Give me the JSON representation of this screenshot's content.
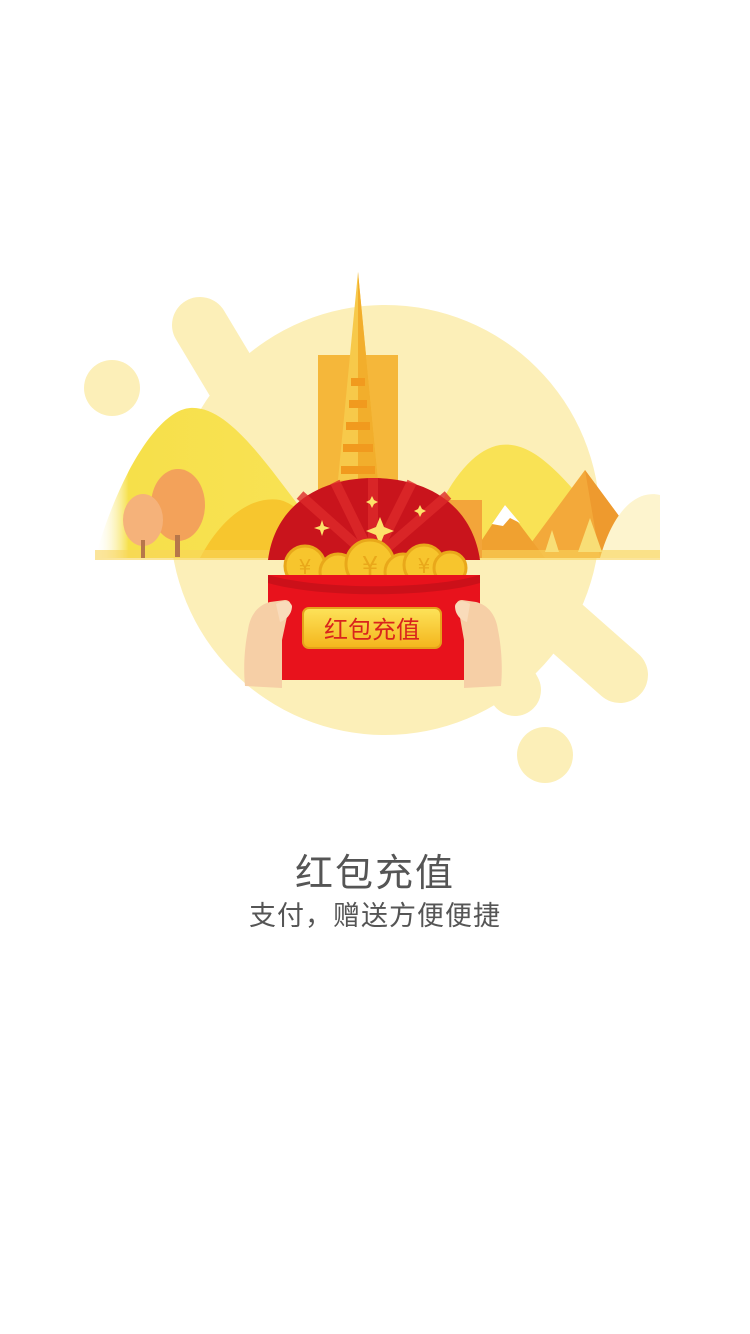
{
  "onboarding": {
    "title": "红包充值",
    "subtitle": "支付，赠送方便便捷"
  },
  "illustration": {
    "envelope_label": "红包充值",
    "coin_symbol": "¥",
    "colors": {
      "envelope_red": "#E8121C",
      "envelope_dark": "#C9141C",
      "gold": "#F7C52D",
      "pale_yellow": "#FCEFB4",
      "tower_orange": "#F5B73A",
      "skin": "#F6CFA6"
    }
  }
}
